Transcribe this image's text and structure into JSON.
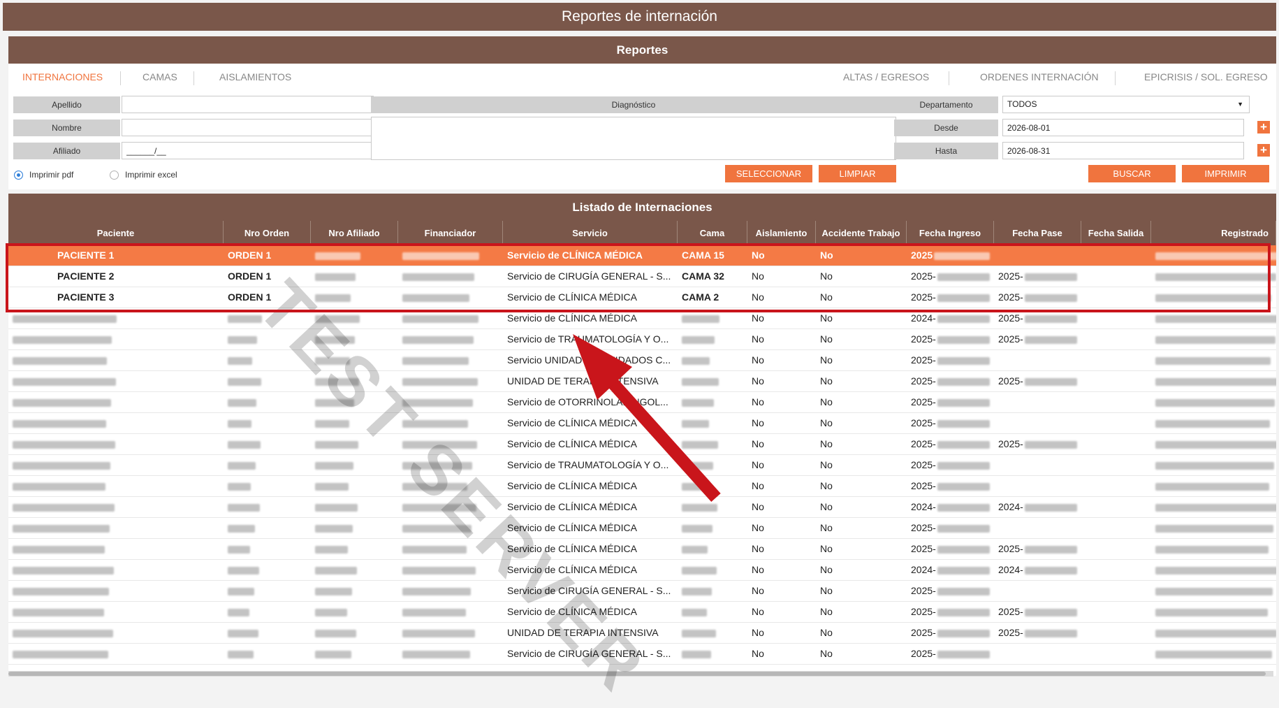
{
  "window": {
    "title": "Reportes de internación"
  },
  "reportes_panel": {
    "title": "Reportes",
    "tabs": [
      {
        "label": "INTERNACIONES",
        "active": true
      },
      {
        "label": "CAMAS"
      },
      {
        "label": "AISLAMIENTOS"
      },
      {
        "label": "ALTAS / EGRESOS"
      },
      {
        "label": "ORDENES INTERNACIÓN"
      },
      {
        "label": "EPICRISIS / SOL. EGRESO"
      }
    ],
    "fields": {
      "apellido_label": "Apellido",
      "nombre_label": "Nombre",
      "afiliado_label": "Afiliado",
      "afiliado_value": "______/__",
      "diagnostico_label": "Diagnóstico",
      "departamento_label": "Departamento",
      "departamento_value": "TODOS",
      "desde_label": "Desde",
      "desde_value": "2026-08-01",
      "hasta_label": "Hasta",
      "hasta_value": "2026-08-31"
    },
    "radios": {
      "pdf": "Imprimir pdf",
      "excel": "Imprimir excel",
      "selected": "pdf"
    },
    "buttons": {
      "seleccionar": "SELECCIONAR",
      "limpiar": "LIMPIAR",
      "buscar": "BUSCAR",
      "imprimir": "IMPRIMIR"
    },
    "accent_color": "#f0743e",
    "header_color": "#7a574a"
  },
  "listado": {
    "title": "Listado de Internaciones",
    "columns": [
      "Paciente",
      "Nro Orden",
      "Nro Afiliado",
      "Financiador",
      "Servicio",
      "Cama",
      "Aislamiento",
      "Accidente Trabajo",
      "Fecha Ingreso",
      "Fecha Pase",
      "Fecha Salida",
      "Registrado"
    ],
    "rows": [
      {
        "paciente": "PACIENTE 1",
        "orden": "ORDEN 1",
        "servicio": "Servicio de CLÍNICA MÉDICA",
        "cama": "CAMA 15",
        "aislamiento": "No",
        "accidente": "No",
        "ingreso": "2025",
        "pase": "",
        "selected": true
      },
      {
        "paciente": "PACIENTE 2",
        "orden": "ORDEN 1",
        "servicio": "Servicio de CIRUGÍA GENERAL - S...",
        "cama": "CAMA 32",
        "aislamiento": "No",
        "accidente": "No",
        "ingreso": "2025-",
        "pase": "2025-"
      },
      {
        "paciente": "PACIENTE 3",
        "orden": "ORDEN 1",
        "servicio": "Servicio de CLÍNICA MÉDICA",
        "cama": "CAMA 2",
        "aislamiento": "No",
        "accidente": "No",
        "ingreso": "2025-",
        "pase": "2025-"
      },
      {
        "paciente": "",
        "orden": "",
        "servicio": "Servicio de CLÍNICA MÉDICA",
        "cama": "",
        "aislamiento": "No",
        "accidente": "No",
        "ingreso": "2024-",
        "pase": "2025-"
      },
      {
        "paciente": "",
        "orden": "",
        "servicio": "Servicio de TRAUMATOLOGÍA Y O...",
        "cama": "",
        "aislamiento": "No",
        "accidente": "No",
        "ingreso": "2025-",
        "pase": "2025-"
      },
      {
        "paciente": "",
        "orden": "",
        "servicio": "Servicio UNIDAD DE CUIDADOS C...",
        "cama": "",
        "aislamiento": "No",
        "accidente": "No",
        "ingreso": "2025-",
        "pase": ""
      },
      {
        "paciente": "",
        "orden": "",
        "servicio": "UNIDAD DE TERAPIA INTENSIVA",
        "cama": "",
        "aislamiento": "No",
        "accidente": "No",
        "ingreso": "2025-",
        "pase": "2025-"
      },
      {
        "paciente": "",
        "orden": "",
        "servicio": "Servicio de OTORRINOLARINGOL...",
        "cama": "",
        "aislamiento": "No",
        "accidente": "No",
        "ingreso": "2025-",
        "pase": ""
      },
      {
        "paciente": "",
        "orden": "",
        "servicio": "Servicio de CLÍNICA MÉDICA",
        "cama": "",
        "aislamiento": "No",
        "accidente": "No",
        "ingreso": "2025-",
        "pase": ""
      },
      {
        "paciente": "",
        "orden": "",
        "servicio": "Servicio de CLÍNICA MÉDICA",
        "cama": "",
        "aislamiento": "No",
        "accidente": "No",
        "ingreso": "2025-",
        "pase": "2025-"
      },
      {
        "paciente": "",
        "orden": "",
        "servicio": "Servicio de TRAUMATOLOGÍA Y O...",
        "cama": "",
        "aislamiento": "No",
        "accidente": "No",
        "ingreso": "2025-",
        "pase": ""
      },
      {
        "paciente": "",
        "orden": "",
        "servicio": "Servicio de CLÍNICA MÉDICA",
        "cama": "",
        "aislamiento": "No",
        "accidente": "No",
        "ingreso": "2025-",
        "pase": ""
      },
      {
        "paciente": "",
        "orden": "",
        "servicio": "Servicio de CLÍNICA MÉDICA",
        "cama": "",
        "aislamiento": "No",
        "accidente": "No",
        "ingreso": "2024-",
        "pase": "2024-"
      },
      {
        "paciente": "",
        "orden": "",
        "servicio": "Servicio de CLÍNICA MÉDICA",
        "cama": "",
        "aislamiento": "No",
        "accidente": "No",
        "ingreso": "2025-",
        "pase": ""
      },
      {
        "paciente": "",
        "orden": "",
        "servicio": "Servicio de CLÍNICA MÉDICA",
        "cama": "",
        "aislamiento": "No",
        "accidente": "No",
        "ingreso": "2025-",
        "pase": "2025-"
      },
      {
        "paciente": "",
        "orden": "",
        "servicio": "Servicio de CLÍNICA MÉDICA",
        "cama": "",
        "aislamiento": "No",
        "accidente": "No",
        "ingreso": "2024-",
        "pase": "2024-"
      },
      {
        "paciente": "",
        "orden": "",
        "servicio": "Servicio de CIRUGÍA GENERAL - S...",
        "cama": "",
        "aislamiento": "No",
        "accidente": "No",
        "ingreso": "2025-",
        "pase": ""
      },
      {
        "paciente": "",
        "orden": "",
        "servicio": "Servicio de CLÍNICA MÉDICA",
        "cama": "",
        "aislamiento": "No",
        "accidente": "No",
        "ingreso": "2025-",
        "pase": "2025-"
      },
      {
        "paciente": "",
        "orden": "",
        "servicio": "UNIDAD DE TERAPIA INTENSIVA",
        "cama": "",
        "aislamiento": "No",
        "accidente": "No",
        "ingreso": "2025-",
        "pase": "2025-"
      },
      {
        "paciente": "",
        "orden": "",
        "servicio": "Servicio de CIRUGÍA GENERAL - S...",
        "cama": "",
        "aislamiento": "No",
        "accidente": "No",
        "ingreso": "2025-",
        "pase": ""
      }
    ],
    "selected_row_color": "#f47a45"
  },
  "overlay": {
    "watermark": "TEST SERVER",
    "highlight_color": "#c9151b"
  }
}
